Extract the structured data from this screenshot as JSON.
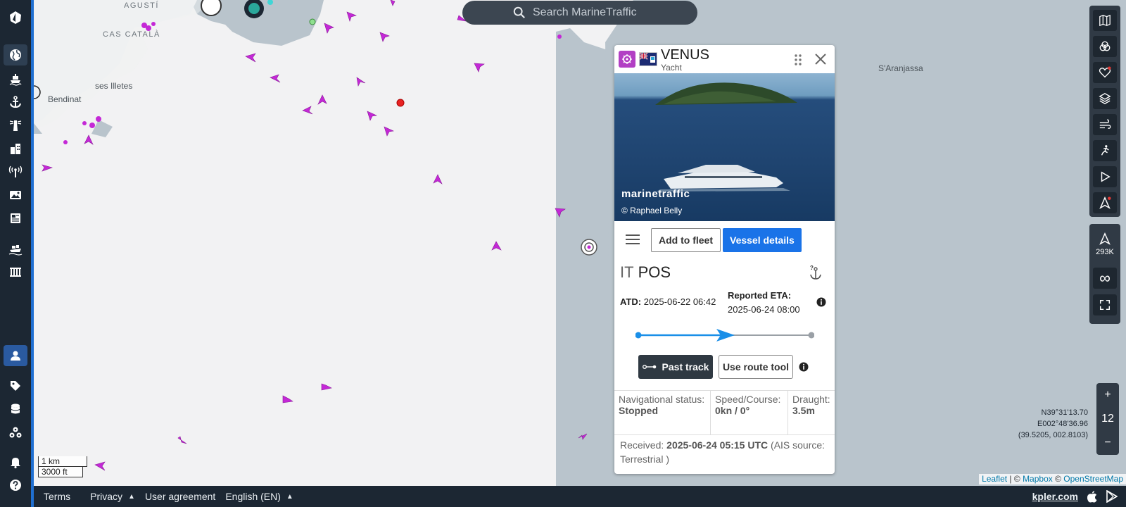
{
  "search": {
    "placeholder": "Search MarineTraffic"
  },
  "map": {
    "place_labels": [
      "AGUSTÍ",
      "CAS CATALÀ",
      "ses Illetes",
      "Bendinat",
      "S'Aranjassa"
    ],
    "scale_km": "1 km",
    "scale_ft": "3000 ft",
    "coords": {
      "lat": "N39°31'13.70",
      "lon": "E002°48'36.96",
      "decimal": "(39.5205, 002.8103)"
    },
    "zoom_level": "12",
    "vessel_count": "293K",
    "attribution": {
      "leaflet": "Leaflet",
      "sep1": " | © ",
      "mapbox": "Mapbox",
      "sep2": " © ",
      "osm": "OpenStreetMap"
    }
  },
  "sidebar": {
    "items": [
      "logo-icon",
      "globe-icon",
      "ship-icon",
      "anchor-icon",
      "lighthouse-icon",
      "building-icon",
      "antenna-icon",
      "photo-icon",
      "news-icon",
      "cargo-icon",
      "port-icon",
      "user-icon",
      "tag-icon",
      "database-icon",
      "api-icon",
      "bell-icon",
      "help-icon"
    ]
  },
  "right_tools": [
    "map-icon",
    "filter-icon",
    "heart-icon",
    "layers-icon",
    "wind-icon",
    "measure-icon",
    "play-icon",
    "navigation-icon"
  ],
  "panel": {
    "vessel_name": "VENUS",
    "vessel_type": "Yacht",
    "photo_watermark": "marinetraffic",
    "photo_credit": "© Raphael Belly",
    "add_to_fleet": "Add to fleet",
    "vessel_details": "Vessel details",
    "route_from": "IT",
    "route_to": "POS",
    "atd_label": "ATD:",
    "atd_value": "2025-06-22 06:42",
    "eta_label": "Reported ETA:",
    "eta_value": "2025-06-24 08:00",
    "progress_fraction": 0.5,
    "past_track": "Past track",
    "use_route_tool": "Use route tool",
    "nav_status_label": "Navigational status:",
    "nav_status_value": "Stopped",
    "speed_label": "Speed/Course:",
    "speed_value": "0kn / 0°",
    "draught_label": "Draught:",
    "draught_value": "3.5m",
    "received_label": "Received:",
    "received_value": "2025-06-24 05:15 UTC",
    "received_source": "(AIS source: Terrestrial )"
  },
  "footer": {
    "terms": "Terms",
    "privacy": "Privacy",
    "user_agreement": "User agreement",
    "language": "English (EN)",
    "kpler": "kpler.com"
  },
  "colors": {
    "accent": "#1a73e8",
    "vessel_magenta": "#c428d6",
    "sidebar_bg": "#1c2733"
  }
}
